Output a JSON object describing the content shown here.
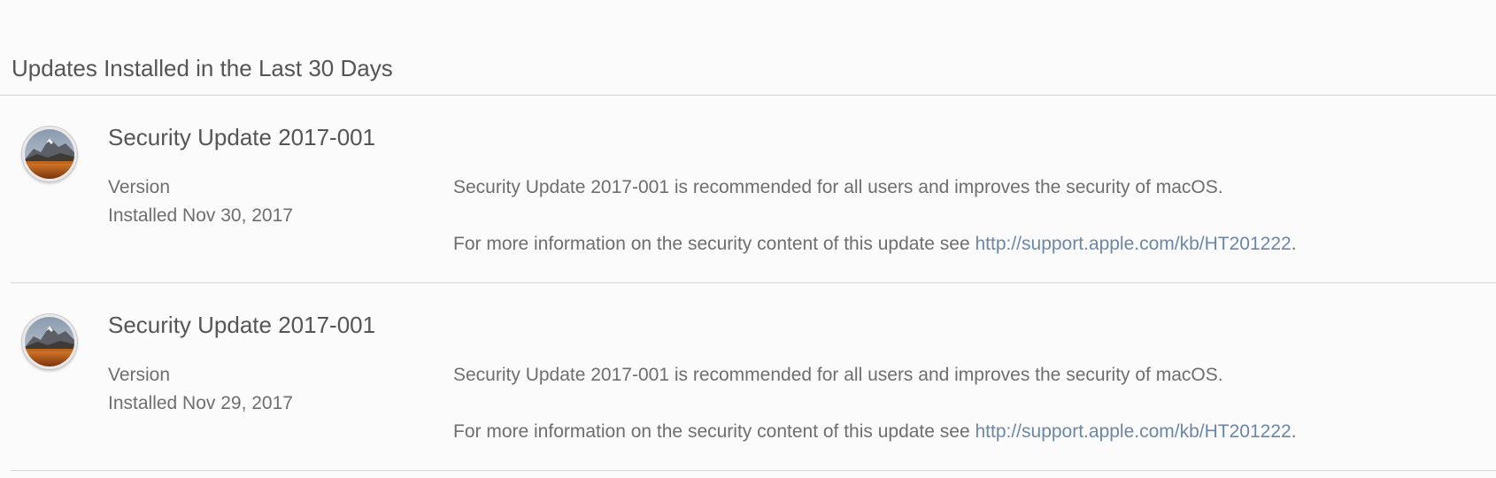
{
  "section": {
    "title": "Updates Installed in the Last 30 Days"
  },
  "updates": [
    {
      "icon": "macos-high-sierra-icon",
      "title": "Security Update 2017-001",
      "version_label": "Version",
      "installed": "Installed Nov 30, 2017",
      "description": "Security Update 2017-001 is recommended for all users and improves the security of macOS.",
      "more_info_prefix": "For more information on the security content of this update see ",
      "link_text": "http://support.apple.com/kb/HT201222",
      "more_info_suffix": "."
    },
    {
      "icon": "macos-high-sierra-icon",
      "title": "Security Update 2017-001",
      "version_label": "Version",
      "installed": "Installed Nov 29, 2017",
      "description": "Security Update 2017-001 is recommended for all users and improves the security of macOS.",
      "more_info_prefix": "For more information on the security content of this update see ",
      "link_text": "http://support.apple.com/kb/HT201222",
      "more_info_suffix": "."
    }
  ],
  "colors": {
    "link": "#6b87a8",
    "divider": "#d6d6d6",
    "text": "#6e6e6e",
    "title": "#555555"
  }
}
